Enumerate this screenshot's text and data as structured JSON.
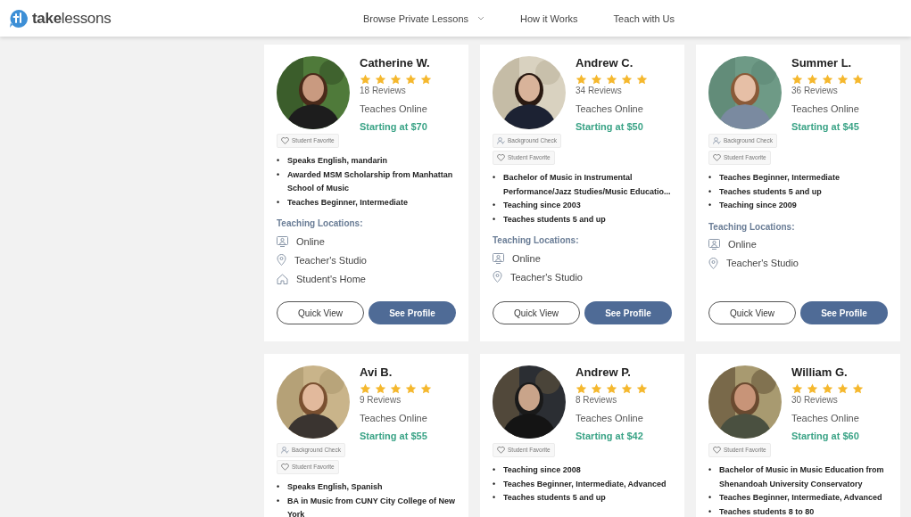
{
  "header": {
    "logo": "**take**lessons",
    "nav": [
      {
        "label": "Browse Private Lessons",
        "dropdown": true
      },
      {
        "label": "How it Works",
        "dropdown": false
      },
      {
        "label": "Teach with Us",
        "dropdown": false
      }
    ]
  },
  "teachers": [
    {
      "photo": {
        "kind": "picture"
      },
      "name": "Catherine W.",
      "stars": 5,
      "reviews": "18 Reviews",
      "teaches": "Teaches Online",
      "price": "Starting at $70",
      "badges": [
        {
          "kind": "favorite",
          "label": "Student Favorite"
        }
      ],
      "bullets": [
        {
          "marker": "•",
          "text": "Speaks English, mandarin"
        },
        {
          "marker": "•",
          "text": "Awarded MSM Scholarship from Manhattan School of Music"
        },
        {
          "marker": "•",
          "text": "Teaches Beginner, Intermediate"
        }
      ],
      "locations_title": "Teaching Locations:",
      "locations": [
        {
          "kind": "online",
          "label": "Online"
        },
        {
          "kind": "studio",
          "label": "Teacher's Studio"
        },
        {
          "kind": "home",
          "label": "Student's Home"
        }
      ],
      "buttons": [
        "Quick View",
        "See Profile"
      ]
    },
    {
      "photo": {
        "kind": "picture"
      },
      "name": "Andrew C.",
      "stars": 5,
      "reviews": "34 Reviews",
      "teaches": "Teaches Online",
      "price": "Starting at $50",
      "badges": [
        {
          "kind": "background",
          "label": "Background Check"
        },
        {
          "kind": "favorite",
          "label": "Student Favorite"
        }
      ],
      "bullets": [
        {
          "marker": "•",
          "text": "Bachelor of Music in Instrumental Performance/Jazz Studies/Music Educatio..."
        },
        {
          "marker": "•",
          "text": "Teaching since 2003"
        },
        {
          "marker": "•",
          "text": "Teaches students 5 and up"
        }
      ],
      "locations_title": "Teaching Locations:",
      "locations": [
        {
          "kind": "online",
          "label": "Online"
        },
        {
          "kind": "studio",
          "label": "Teacher's Studio"
        }
      ],
      "buttons": [
        "Quick View",
        "See Profile"
      ]
    },
    {
      "photo": {
        "kind": "picture"
      },
      "name": "Summer L.",
      "stars": 5,
      "reviews": "36 Reviews",
      "teaches": "Teaches Online",
      "price": "Starting at $45",
      "badges": [
        {
          "kind": "background",
          "label": "Background Check"
        },
        {
          "kind": "favorite",
          "label": "Student Favorite"
        }
      ],
      "bullets": [
        {
          "marker": "•",
          "text": "Teaches Beginner, Intermediate"
        },
        {
          "marker": "•",
          "text": "Teaches students 5 and up"
        },
        {
          "marker": "•",
          "text": "Teaching since 2009"
        }
      ],
      "locations_title": "Teaching Locations:",
      "locations": [
        {
          "kind": "online",
          "label": "Online"
        },
        {
          "kind": "studio",
          "label": "Teacher's Studio"
        }
      ],
      "buttons": [
        "Quick View",
        "See Profile"
      ]
    },
    {
      "photo": {
        "kind": "picture"
      },
      "name": "Avi B.",
      "stars": 5,
      "reviews": "9 Reviews",
      "teaches": "Teaches Online",
      "price": "Starting at $55",
      "badges": [
        {
          "kind": "background",
          "label": "Background Check"
        },
        {
          "kind": "favorite",
          "label": "Student Favorite"
        }
      ],
      "bullets": [
        {
          "marker": "•",
          "text": "Speaks English, Spanish"
        },
        {
          "marker": "•",
          "text": "BA in Music from CUNY City College of New York"
        }
      ]
    },
    {
      "photo": {
        "kind": "picture"
      },
      "name": "Andrew P.",
      "stars": 5,
      "reviews": "8 Reviews",
      "teaches": "Teaches Online",
      "price": "Starting at $42",
      "badges": [
        {
          "kind": "favorite",
          "label": "Student Favorite"
        }
      ],
      "bullets": [
        {
          "marker": "•",
          "text": "Teaching since 2008"
        },
        {
          "marker": "•",
          "text": "Teaches Beginner, Intermediate, Advanced"
        },
        {
          "marker": "•",
          "text": "Teaches students 5 and up"
        }
      ]
    },
    {
      "photo": {
        "kind": "picture"
      },
      "name": "William G.",
      "stars": 5,
      "reviews": "30 Reviews",
      "teaches": "Teaches Online",
      "price": "Starting at $60",
      "badges": [
        {
          "kind": "favorite",
          "label": "Student Favorite"
        }
      ],
      "bullets": [
        {
          "marker": "•",
          "text": "Bachelor of Music in Music Education from Shenandoah University Conservatory"
        },
        {
          "marker": "•",
          "text": "Teaches Beginner, Intermediate, Advanced"
        },
        {
          "marker": "•",
          "text": "Teaches students 8 to 80"
        }
      ]
    }
  ]
}
